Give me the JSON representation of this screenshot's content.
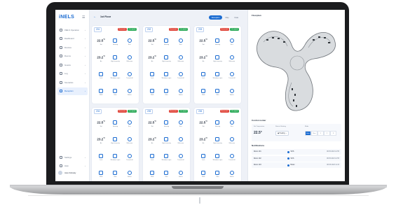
{
  "app": {
    "logo": "iNELS"
  },
  "sidebar": {
    "menu_icon": "hamburger-icon",
    "items": [
      {
        "label": "iNELS Operation",
        "icon": "home-icon"
      },
      {
        "label": "Dashboard",
        "icon": "dashboard-icon"
      },
      {
        "label": "Devices",
        "icon": "device-icon"
      },
      {
        "label": "Rooms",
        "icon": "room-icon"
      },
      {
        "label": "Guests",
        "icon": "guest-icon"
      },
      {
        "label": "Log",
        "icon": "log-icon"
      },
      {
        "label": "Scenarios",
        "icon": "scenario-icon"
      },
      {
        "label": "Reception",
        "icon": "reception-icon",
        "active": true
      }
    ],
    "bottom_items": [
      {
        "label": "Settings",
        "icon": "gear-icon"
      },
      {
        "label": "Help",
        "icon": "help-icon"
      }
    ],
    "user": {
      "name": "Jane Kobosky"
    }
  },
  "topbar": {
    "back_icon": "arrow-left-icon",
    "title": "1st Floor",
    "segments": [
      "Reception",
      "Map",
      "Data"
    ],
    "active_segment": 0
  },
  "rooms": [
    {
      "number": "201",
      "reserved": "Reserved",
      "occupied": "Occupied"
    },
    {
      "number": "202",
      "reserved": "Reserved",
      "occupied": "Occupied"
    },
    {
      "number": "203",
      "reserved": "Reserved",
      "occupied": "Occupied"
    },
    {
      "number": "204",
      "reserved": "Reserved",
      "occupied": "Occupied"
    },
    {
      "number": "205",
      "reserved": "Reserved",
      "occupied": "Occupied"
    },
    {
      "number": "206",
      "reserved": "Reserved",
      "occupied": "Occupied"
    }
  ],
  "room_cells": [
    {
      "type": "value",
      "value": "22.5",
      "unit": "°C",
      "label": "Set"
    },
    {
      "type": "icon",
      "icon": "heating-icon",
      "label": "Heating"
    },
    {
      "type": "icon",
      "icon": "eco-icon",
      "label": "Eco"
    },
    {
      "type": "value",
      "value": "23.2",
      "unit": "°C",
      "label": "Air"
    },
    {
      "type": "icon",
      "icon": "fan-icon",
      "label": "High Intensity"
    },
    {
      "type": "icon",
      "icon": "welcome-icon",
      "label": "Welcome"
    },
    {
      "type": "icon",
      "icon": "lock-icon",
      "label": "Lock"
    },
    {
      "type": "icon",
      "icon": "window-icon",
      "label": "Windows open"
    },
    {
      "type": "icon",
      "icon": "power-icon",
      "label": "Turned off"
    },
    {
      "type": "icon",
      "icon": "dnd-icon",
      "label": "DND"
    },
    {
      "type": "icon",
      "icon": "minibar-icon",
      "label": "Mini"
    },
    {
      "type": "icon",
      "icon": "butler-icon",
      "label": "Butler"
    }
  ],
  "right_panel": {
    "floorplan_title": "Floorplan",
    "control_title": "Control center",
    "set_temp_label": "Set Temperature",
    "set_temp_value": "22.5°",
    "heating_label": "State of Heating",
    "heating_value": "Heating",
    "mode_label": "Mode",
    "modes": [
      "Auto",
      "Eco",
      "1",
      "2",
      "3"
    ],
    "active_mode": 0,
    "notifications_title": "Notifications",
    "notifications": [
      {
        "room": "Room 101",
        "type": "SOS",
        "icon": "sos-icon",
        "date": "08.05.2023 12:55"
      },
      {
        "room": "Room 102",
        "type": "SOS",
        "icon": "sos-icon",
        "date": "08.05.2023 12:55"
      },
      {
        "room": "Room 103",
        "type": "Butler",
        "icon": "butler-icon",
        "date": "08.05.2023 11:15"
      }
    ]
  },
  "colors": {
    "accent": "#1a6bd1",
    "reserved": "#e0453a",
    "occupied": "#2eab5a"
  }
}
